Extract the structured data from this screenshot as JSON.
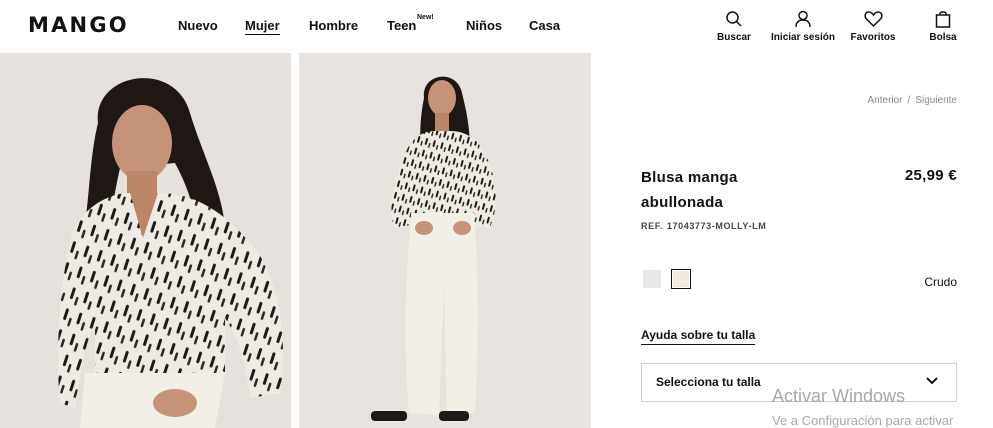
{
  "header": {
    "logo": "MANGO",
    "nav": [
      {
        "label": "Nuevo"
      },
      {
        "label": "Mujer"
      },
      {
        "label": "Hombre"
      },
      {
        "label": "Teen",
        "tag": "New!"
      },
      {
        "label": "Niños"
      },
      {
        "label": "Casa"
      }
    ],
    "active_nav": "Mujer",
    "actions": [
      {
        "label": "Buscar",
        "icon": "search-icon"
      },
      {
        "label": "Iniciar sesión",
        "icon": "user-icon"
      },
      {
        "label": "Favoritos",
        "icon": "heart-icon"
      },
      {
        "label": "Bolsa",
        "icon": "bag-icon"
      }
    ]
  },
  "pagination": {
    "prev": "Anterior",
    "separator": "/",
    "next": "Siguiente"
  },
  "product": {
    "title": "Blusa manga abullonada",
    "price": "25,99 €",
    "ref_label": "REF.",
    "ref_code": "17043773-MOLLY-LM",
    "colors": [
      {
        "name": "light-grey",
        "hex": "#e9e9e9"
      },
      {
        "name": "Crudo",
        "hex": "#f3ead7"
      }
    ],
    "selected_color": "Crudo",
    "size_help": "Ayuda sobre tu talla",
    "size_select_label": "Selecciona tu talla"
  },
  "watermark": {
    "line1": "Activar Windows",
    "line2": "Ve a Configuración para activar"
  },
  "colors": {
    "text": "#111111",
    "muted": "#888888",
    "photo_bg": "#e6e1dc"
  }
}
